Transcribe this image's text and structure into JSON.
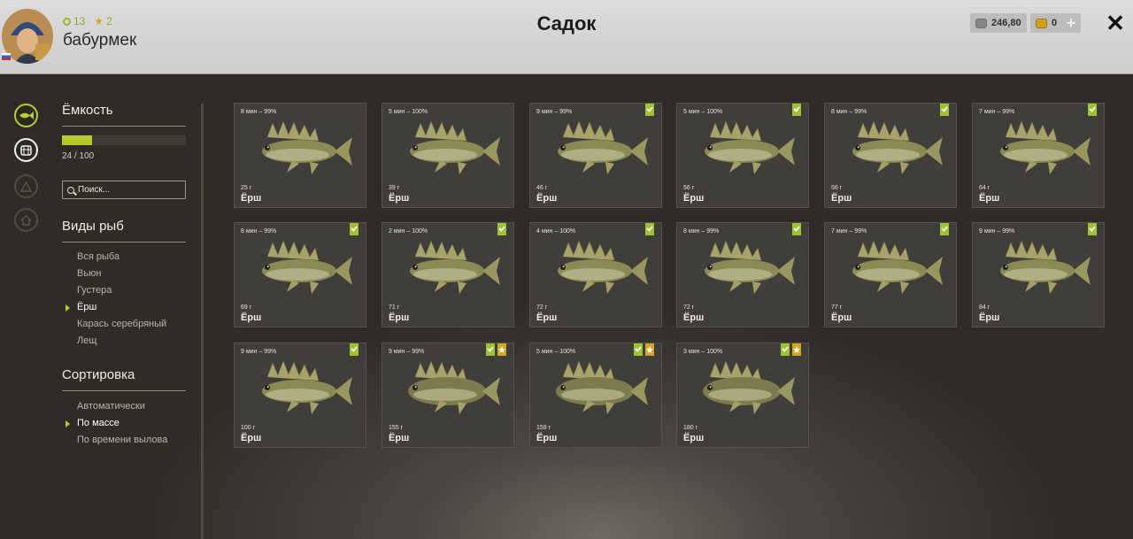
{
  "header": {
    "title": "Садок",
    "username": "бабурмек",
    "level": "13",
    "stars": "2",
    "silver": "246,80",
    "gold": "0"
  },
  "sidebar": {
    "capacity_title": "Ёмкость",
    "capacity_text": "24 / 100",
    "capacity_fraction": 0.24,
    "search_placeholder": "Поиск...",
    "species_title": "Виды рыб",
    "species": [
      {
        "label": "Вся рыба",
        "active": false
      },
      {
        "label": "Вьюн",
        "active": false
      },
      {
        "label": "Густера",
        "active": false
      },
      {
        "label": "Ёрш",
        "active": true
      },
      {
        "label": "Карась серебряный",
        "active": false
      },
      {
        "label": "Лещ",
        "active": false
      }
    ],
    "sort_title": "Сортировка",
    "sort": [
      {
        "label": "Автоматически",
        "active": false
      },
      {
        "label": "По массе",
        "active": true
      },
      {
        "label": "По времени вылова",
        "active": false
      }
    ]
  },
  "fish_cards": [
    {
      "time": "8 мин – 99%",
      "weight": "25 г",
      "name": "Ёрш",
      "green": false,
      "gold": false
    },
    {
      "time": "5 мин – 100%",
      "weight": "39 г",
      "name": "Ёрш",
      "green": false,
      "gold": false
    },
    {
      "time": "9 мин – 99%",
      "weight": "46 г",
      "name": "Ёрш",
      "green": true,
      "gold": false
    },
    {
      "time": "5 мин – 100%",
      "weight": "56 г",
      "name": "Ёрш",
      "green": true,
      "gold": false
    },
    {
      "time": "8 мин – 99%",
      "weight": "56 г",
      "name": "Ёрш",
      "green": true,
      "gold": false
    },
    {
      "time": "7 мин – 99%",
      "weight": "64 г",
      "name": "Ёрш",
      "green": true,
      "gold": false
    },
    {
      "time": "8 мин – 99%",
      "weight": "69 г",
      "name": "Ёрш",
      "green": true,
      "gold": false
    },
    {
      "time": "2 мин – 100%",
      "weight": "71 г",
      "name": "Ёрш",
      "green": true,
      "gold": false
    },
    {
      "time": "4 мин – 100%",
      "weight": "72 г",
      "name": "Ёрш",
      "green": true,
      "gold": false
    },
    {
      "time": "8 мин – 99%",
      "weight": "72 г",
      "name": "Ёрш",
      "green": true,
      "gold": false
    },
    {
      "time": "7 мин – 99%",
      "weight": "77 г",
      "name": "Ёрш",
      "green": true,
      "gold": false
    },
    {
      "time": "9 мин – 99%",
      "weight": "84 г",
      "name": "Ёрш",
      "green": true,
      "gold": false
    },
    {
      "time": "9 мин – 99%",
      "weight": "100 г",
      "name": "Ёрш",
      "green": true,
      "gold": false
    },
    {
      "time": "9 мин – 99%",
      "weight": "155 г",
      "name": "Ёрш",
      "green": true,
      "gold": true
    },
    {
      "time": "5 мин – 100%",
      "weight": "159 г",
      "name": "Ёрш",
      "green": true,
      "gold": true
    },
    {
      "time": "3 мин – 100%",
      "weight": "180 г",
      "name": "Ёрш",
      "green": true,
      "gold": true
    }
  ]
}
